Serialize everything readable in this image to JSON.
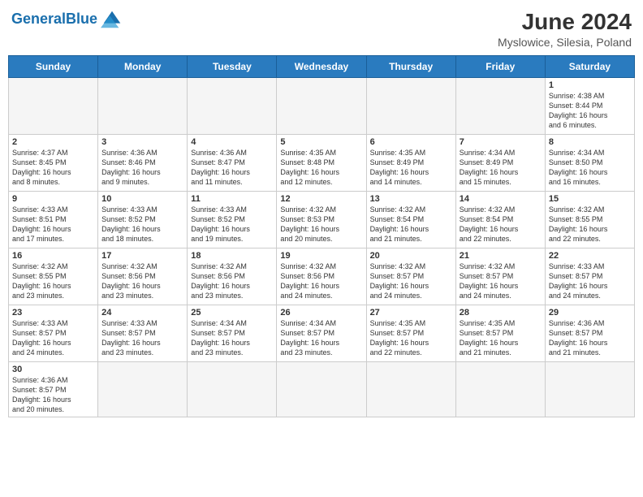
{
  "header": {
    "logo_general": "General",
    "logo_blue": "Blue",
    "title": "June 2024",
    "subtitle": "Myslowice, Silesia, Poland"
  },
  "weekdays": [
    "Sunday",
    "Monday",
    "Tuesday",
    "Wednesday",
    "Thursday",
    "Friday",
    "Saturday"
  ],
  "weeks": [
    [
      {
        "day": "",
        "info": "",
        "empty": true
      },
      {
        "day": "",
        "info": "",
        "empty": true
      },
      {
        "day": "",
        "info": "",
        "empty": true
      },
      {
        "day": "",
        "info": "",
        "empty": true
      },
      {
        "day": "",
        "info": "",
        "empty": true
      },
      {
        "day": "",
        "info": "",
        "empty": true
      },
      {
        "day": "1",
        "info": "Sunrise: 4:38 AM\nSunset: 8:44 PM\nDaylight: 16 hours\nand 6 minutes."
      }
    ],
    [
      {
        "day": "2",
        "info": "Sunrise: 4:37 AM\nSunset: 8:45 PM\nDaylight: 16 hours\nand 8 minutes."
      },
      {
        "day": "3",
        "info": "Sunrise: 4:36 AM\nSunset: 8:46 PM\nDaylight: 16 hours\nand 9 minutes."
      },
      {
        "day": "4",
        "info": "Sunrise: 4:36 AM\nSunset: 8:47 PM\nDaylight: 16 hours\nand 11 minutes."
      },
      {
        "day": "5",
        "info": "Sunrise: 4:35 AM\nSunset: 8:48 PM\nDaylight: 16 hours\nand 12 minutes."
      },
      {
        "day": "6",
        "info": "Sunrise: 4:35 AM\nSunset: 8:49 PM\nDaylight: 16 hours\nand 14 minutes."
      },
      {
        "day": "7",
        "info": "Sunrise: 4:34 AM\nSunset: 8:49 PM\nDaylight: 16 hours\nand 15 minutes."
      },
      {
        "day": "8",
        "info": "Sunrise: 4:34 AM\nSunset: 8:50 PM\nDaylight: 16 hours\nand 16 minutes."
      }
    ],
    [
      {
        "day": "9",
        "info": "Sunrise: 4:33 AM\nSunset: 8:51 PM\nDaylight: 16 hours\nand 17 minutes."
      },
      {
        "day": "10",
        "info": "Sunrise: 4:33 AM\nSunset: 8:52 PM\nDaylight: 16 hours\nand 18 minutes."
      },
      {
        "day": "11",
        "info": "Sunrise: 4:33 AM\nSunset: 8:52 PM\nDaylight: 16 hours\nand 19 minutes."
      },
      {
        "day": "12",
        "info": "Sunrise: 4:32 AM\nSunset: 8:53 PM\nDaylight: 16 hours\nand 20 minutes."
      },
      {
        "day": "13",
        "info": "Sunrise: 4:32 AM\nSunset: 8:54 PM\nDaylight: 16 hours\nand 21 minutes."
      },
      {
        "day": "14",
        "info": "Sunrise: 4:32 AM\nSunset: 8:54 PM\nDaylight: 16 hours\nand 22 minutes."
      },
      {
        "day": "15",
        "info": "Sunrise: 4:32 AM\nSunset: 8:55 PM\nDaylight: 16 hours\nand 22 minutes."
      }
    ],
    [
      {
        "day": "16",
        "info": "Sunrise: 4:32 AM\nSunset: 8:55 PM\nDaylight: 16 hours\nand 23 minutes."
      },
      {
        "day": "17",
        "info": "Sunrise: 4:32 AM\nSunset: 8:56 PM\nDaylight: 16 hours\nand 23 minutes."
      },
      {
        "day": "18",
        "info": "Sunrise: 4:32 AM\nSunset: 8:56 PM\nDaylight: 16 hours\nand 23 minutes."
      },
      {
        "day": "19",
        "info": "Sunrise: 4:32 AM\nSunset: 8:56 PM\nDaylight: 16 hours\nand 24 minutes."
      },
      {
        "day": "20",
        "info": "Sunrise: 4:32 AM\nSunset: 8:57 PM\nDaylight: 16 hours\nand 24 minutes."
      },
      {
        "day": "21",
        "info": "Sunrise: 4:32 AM\nSunset: 8:57 PM\nDaylight: 16 hours\nand 24 minutes."
      },
      {
        "day": "22",
        "info": "Sunrise: 4:33 AM\nSunset: 8:57 PM\nDaylight: 16 hours\nand 24 minutes."
      }
    ],
    [
      {
        "day": "23",
        "info": "Sunrise: 4:33 AM\nSunset: 8:57 PM\nDaylight: 16 hours\nand 24 minutes."
      },
      {
        "day": "24",
        "info": "Sunrise: 4:33 AM\nSunset: 8:57 PM\nDaylight: 16 hours\nand 23 minutes."
      },
      {
        "day": "25",
        "info": "Sunrise: 4:34 AM\nSunset: 8:57 PM\nDaylight: 16 hours\nand 23 minutes."
      },
      {
        "day": "26",
        "info": "Sunrise: 4:34 AM\nSunset: 8:57 PM\nDaylight: 16 hours\nand 23 minutes."
      },
      {
        "day": "27",
        "info": "Sunrise: 4:35 AM\nSunset: 8:57 PM\nDaylight: 16 hours\nand 22 minutes."
      },
      {
        "day": "28",
        "info": "Sunrise: 4:35 AM\nSunset: 8:57 PM\nDaylight: 16 hours\nand 21 minutes."
      },
      {
        "day": "29",
        "info": "Sunrise: 4:36 AM\nSunset: 8:57 PM\nDaylight: 16 hours\nand 21 minutes."
      }
    ],
    [
      {
        "day": "30",
        "info": "Sunrise: 4:36 AM\nSunset: 8:57 PM\nDaylight: 16 hours\nand 20 minutes.",
        "last": true
      },
      {
        "day": "",
        "info": "",
        "empty": true,
        "last": true
      },
      {
        "day": "",
        "info": "",
        "empty": true,
        "last": true
      },
      {
        "day": "",
        "info": "",
        "empty": true,
        "last": true
      },
      {
        "day": "",
        "info": "",
        "empty": true,
        "last": true
      },
      {
        "day": "",
        "info": "",
        "empty": true,
        "last": true
      },
      {
        "day": "",
        "info": "",
        "empty": true,
        "last": true
      }
    ]
  ]
}
